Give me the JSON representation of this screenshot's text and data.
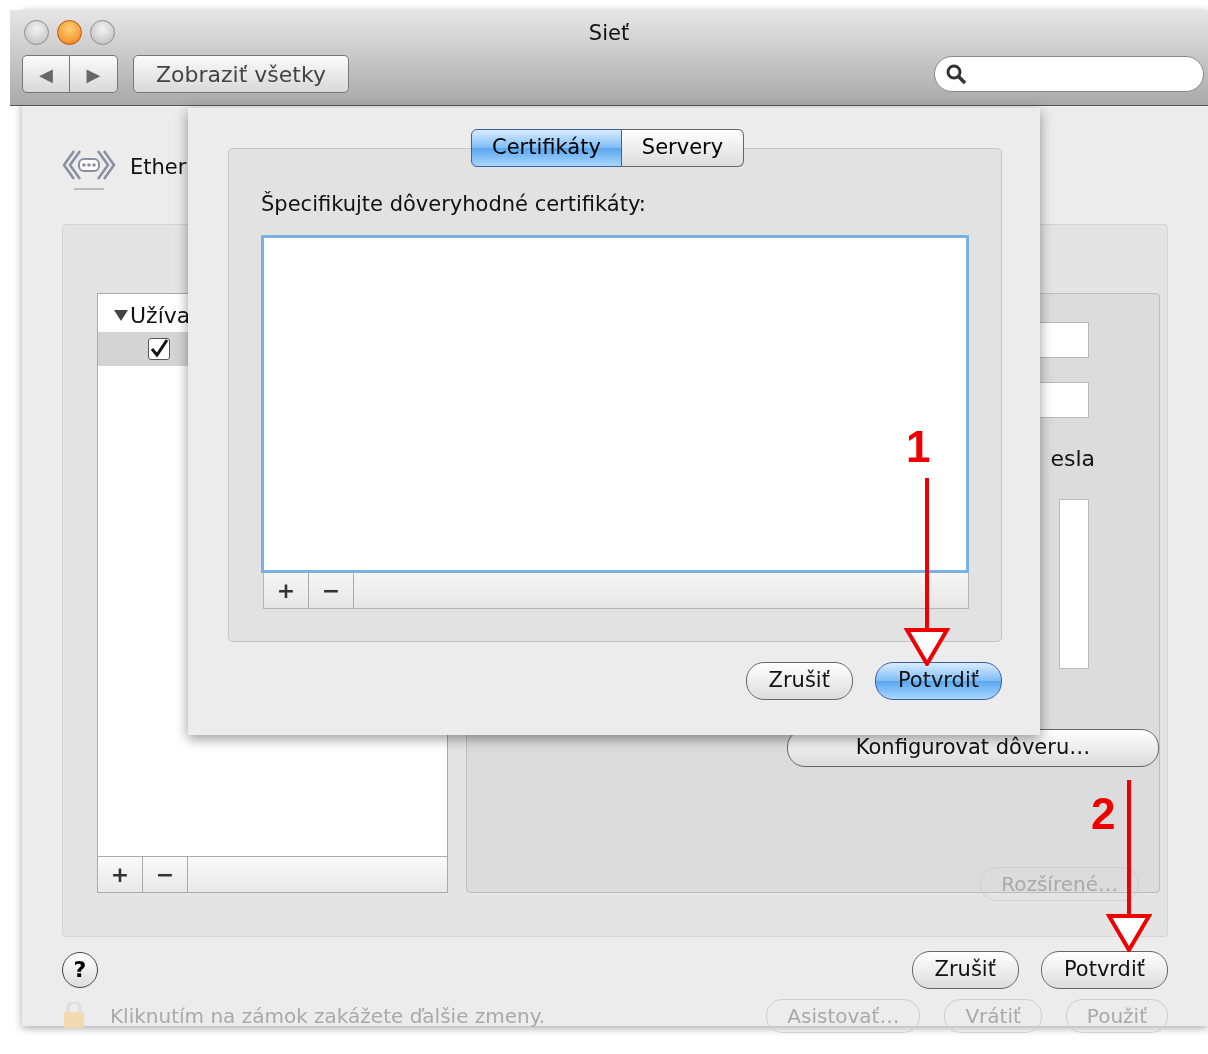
{
  "window": {
    "title": "Sieť",
    "nav_buttons": [
      "◀",
      "▶"
    ],
    "show_all_button": "Zobraziť všetky"
  },
  "background": {
    "header": "Ether",
    "tree": [
      {
        "label": "Užíva",
        "expanded": true,
        "children": [
          {
            "checked": true,
            "selected": true
          }
        ]
      }
    ],
    "list_buttons": [
      "+",
      "−"
    ],
    "right_panel": {
      "label": "esla",
      "configure_button": "Konfigurovat dôveru…",
      "advanced_button": "Rozšírené…"
    },
    "help": "?",
    "buttons": [
      {
        "label": "Zrušiť",
        "default": false
      },
      {
        "label": "Potvrdiť",
        "default": false
      }
    ],
    "status_text": "Kliknutím na zámok zakážete ďalšie zmeny.",
    "status_buttons": [
      "Asistovať…",
      "Vrátiť",
      "Použiť"
    ]
  },
  "sheet": {
    "tabs": [
      {
        "label": "Certifikáty",
        "selected": true
      },
      {
        "label": "Servery",
        "selected": false
      }
    ],
    "label": "Špecifikujte dôveryhodné certifikáty:",
    "list_buttons": [
      "+",
      "−"
    ],
    "buttons": [
      {
        "label": "Zrušiť",
        "default": false
      },
      {
        "label": "Potvrdiť",
        "default": true
      }
    ]
  },
  "annotations": [
    {
      "number": "1"
    },
    {
      "number": "2"
    }
  ]
}
